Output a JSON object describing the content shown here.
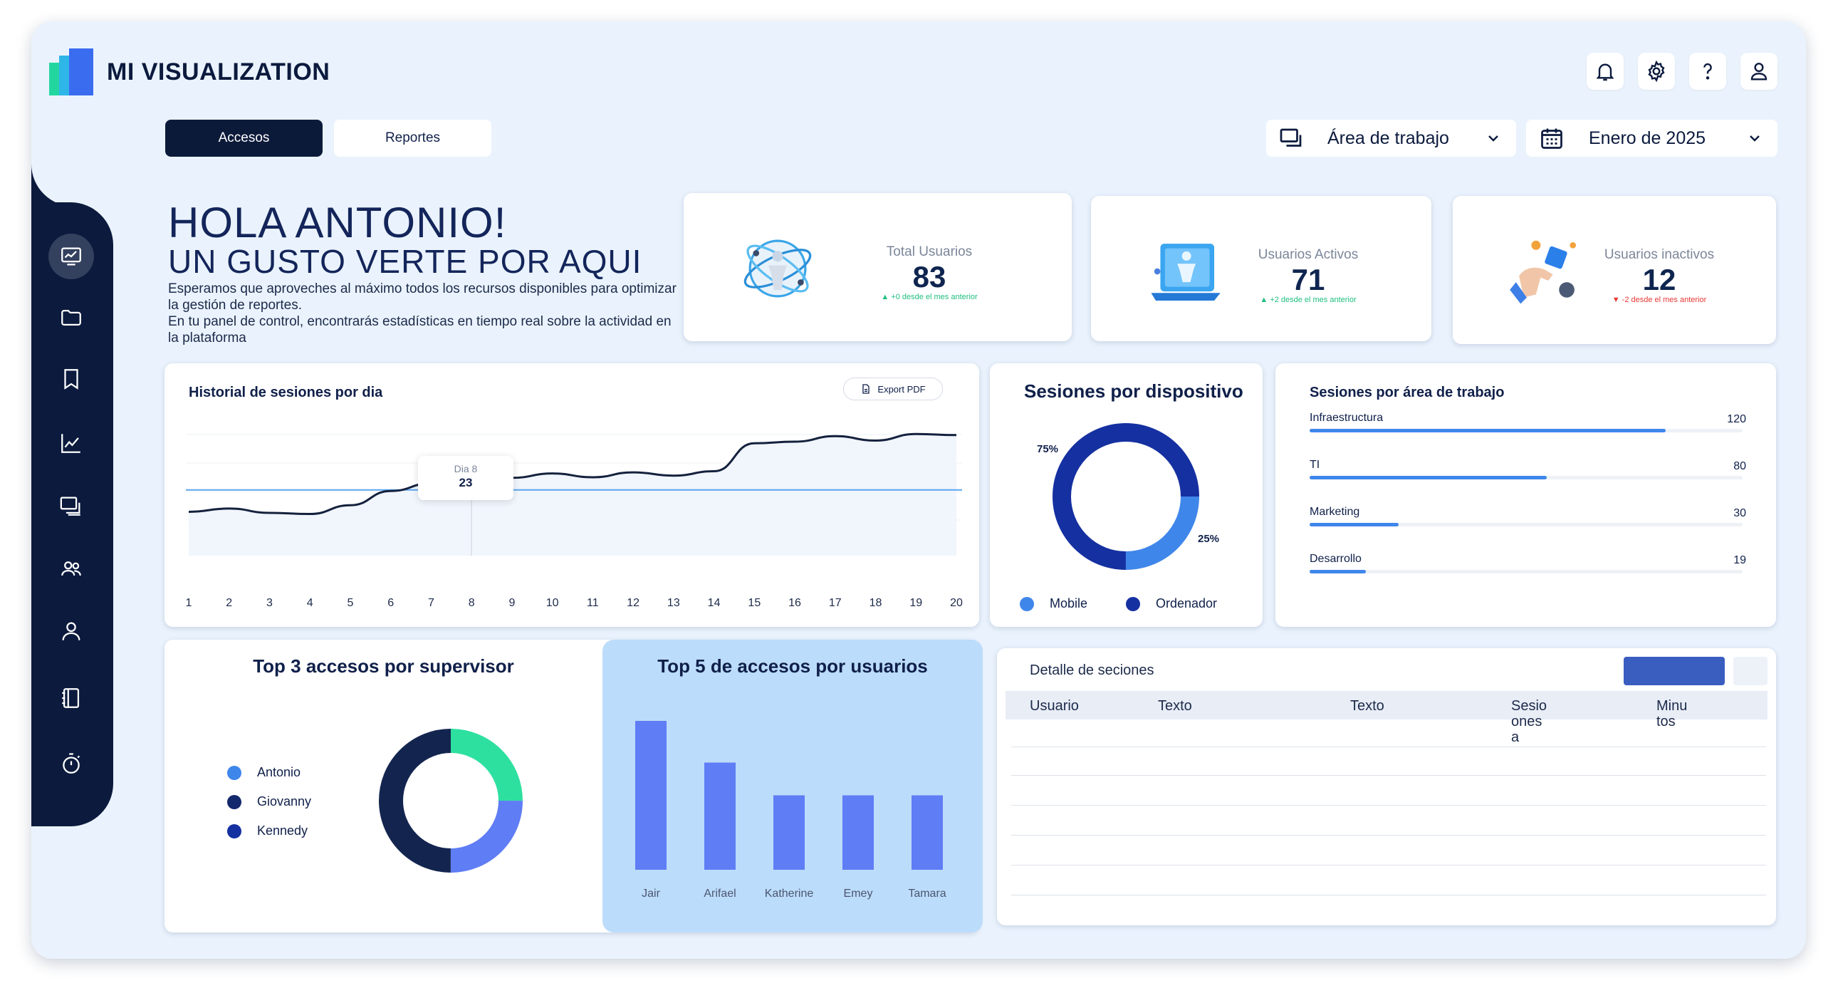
{
  "app": {
    "title": "MI VISUALIZATION"
  },
  "header": {
    "icons": [
      "bell-icon",
      "gear-icon",
      "help-icon",
      "user-icon"
    ],
    "tabs": [
      {
        "label": "Accesos",
        "active": true
      },
      {
        "label": "Reportes",
        "active": false
      }
    ],
    "workspace_select": {
      "value": "Área de trabajo",
      "icon": "workspace-icon"
    },
    "date_select": {
      "value": "Enero de 2025",
      "icon": "calendar-icon"
    }
  },
  "sidebar": {
    "items": [
      {
        "icon": "dashboard-icon",
        "active": true
      },
      {
        "icon": "folder-icon",
        "active": false
      },
      {
        "icon": "bookmark-icon",
        "active": false
      },
      {
        "icon": "chart-line-icon",
        "active": false
      },
      {
        "icon": "screens-icon",
        "active": false
      },
      {
        "icon": "users-icon",
        "active": false
      },
      {
        "icon": "user-icon",
        "active": false
      },
      {
        "icon": "notebook-icon",
        "active": false
      },
      {
        "icon": "timer-icon",
        "active": false
      }
    ]
  },
  "greeting": {
    "title": "HOLA ANTONIO!",
    "subtitle": "UN GUSTO VERTE POR AQUI",
    "text1": "Esperamos que aproveches al máximo todos los recursos disponibles para optimizar la gestión de reportes.",
    "text2": "En tu panel de control, encontrarás estadísticas en tiempo real sobre la actividad en la plataforma"
  },
  "stats": [
    {
      "label": "Total Usuarios",
      "value": "83",
      "delta": "▲ +0 desde el mes anterior",
      "trend": "up"
    },
    {
      "label": "Usuarios Activos",
      "value": "71",
      "delta": "▲ +2 desde el mes anterior",
      "trend": "up"
    },
    {
      "label": "Usuarios inactivos",
      "value": "12",
      "delta": "▼ -2 desde el mes anterior",
      "trend": "down"
    }
  ],
  "sessions_history": {
    "title": "Historial de sesiones por dia",
    "export_label": "Export PDF",
    "tooltip": {
      "label": "Dia 8",
      "value": "23"
    }
  },
  "devices": {
    "title": "Sesiones por dispositivo",
    "pct_labels": [
      "75%",
      "25%"
    ],
    "legend": [
      "Mobile",
      "Ordenador"
    ]
  },
  "areas": {
    "title": "Sesiones por área de trabajo",
    "rows": [
      {
        "label": "Infraestructura",
        "value": "120"
      },
      {
        "label": "TI",
        "value": "80"
      },
      {
        "label": "Marketing",
        "value": "30"
      },
      {
        "label": "Desarrollo",
        "value": "19"
      }
    ]
  },
  "supervisors": {
    "title": "Top 3 accesos por supervisor",
    "legend": [
      "Antonio",
      "Giovanny",
      "Kennedy"
    ]
  },
  "top_users": {
    "title": "Top 5 de accesos por usuarios"
  },
  "sessions_detail": {
    "title": "Detalle de seciones",
    "columns": [
      "Usuario",
      "Texto",
      "Texto",
      "Sesio\nones\na",
      "Minu\ntos"
    ]
  },
  "colors": {
    "navy": "#0b1a3d",
    "accent_blue": "#3f86ea",
    "bar_blue": "#5f7df5",
    "teal": "#2ee0a0",
    "green": "#1fbf7f",
    "red": "#e53935"
  },
  "chart_data": [
    {
      "type": "line",
      "x": [
        1,
        2,
        3,
        4,
        5,
        6,
        7,
        8,
        9,
        10,
        11,
        12,
        13,
        14,
        15,
        16,
        17,
        18,
        19,
        20
      ],
      "series": [
        {
          "values": [
            18,
            18.6,
            17.8,
            17.6,
            19.2,
            21.8,
            23.2,
            23,
            24.2,
            25,
            24.3,
            25.2,
            24.6,
            25.4,
            30.5,
            30.8,
            31.8,
            31,
            32.2,
            32
          ]
        }
      ],
      "annotation": {
        "x": 8,
        "y": 23,
        "label": "Dia 8"
      },
      "reference_line": 22
    },
    {
      "type": "pie",
      "labels": [
        "Mobile",
        "Ordenador"
      ],
      "values": [
        25,
        75
      ],
      "colors": [
        "#3f86ea",
        "#1530a0"
      ]
    },
    {
      "type": "bar",
      "orientation": "horizontal",
      "categories": [
        "Infraestructura",
        "TI",
        "Marketing",
        "Desarrollo"
      ],
      "values": [
        120,
        80,
        30,
        19
      ]
    },
    {
      "type": "pie",
      "labels": [
        "Antonio",
        "Giovanny",
        "Kennedy"
      ],
      "values": [
        25,
        25,
        50
      ],
      "colors": [
        "#2ee0a0",
        "#5f7df5",
        "#13254f"
      ]
    },
    {
      "type": "bar",
      "categories": [
        "Jair",
        "Arifael",
        "Katherine",
        "Emey",
        "Tamara"
      ],
      "values": [
        100,
        72,
        50,
        50,
        50
      ]
    }
  ]
}
